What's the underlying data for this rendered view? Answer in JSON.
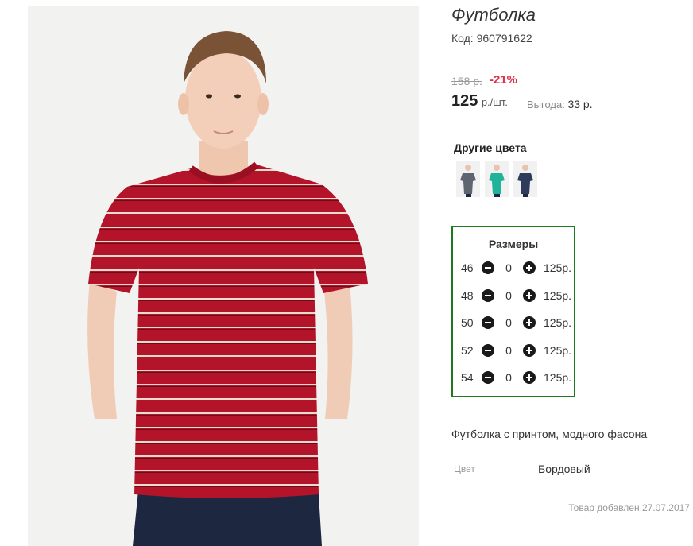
{
  "product": {
    "title": "Футболка",
    "code_label": "Код:",
    "code_value": "960791622",
    "old_price": "158 р.",
    "discount": "-21%",
    "price_value": "125",
    "price_unit": "р./шт.",
    "savings_label": "Выгода:",
    "savings_value": "33 р.",
    "photo_icon": "person-in-striped-tshirt-photo"
  },
  "other_colors": {
    "title": "Другие цвета",
    "items": [
      {
        "name": "grey",
        "color": "#5e6470"
      },
      {
        "name": "turquoise",
        "color": "#1fb39a"
      },
      {
        "name": "navy",
        "color": "#2f3b5c"
      }
    ]
  },
  "sizes": {
    "title": "Размеры",
    "rows": [
      {
        "size": "46",
        "qty": "0",
        "price": "125р."
      },
      {
        "size": "48",
        "qty": "0",
        "price": "125р."
      },
      {
        "size": "50",
        "qty": "0",
        "price": "125р."
      },
      {
        "size": "52",
        "qty": "0",
        "price": "125р."
      },
      {
        "size": "54",
        "qty": "0",
        "price": "125р."
      }
    ]
  },
  "details": {
    "description": "Футболка с принтом, модного фасона",
    "color_label": "Цвет",
    "color_value": "Бордовый",
    "added": "Товар добавлен 27.07.2017"
  },
  "colors": {
    "accent_red": "#d8304a",
    "box_border": "#1f7a1f",
    "shirt": "#b3142a"
  }
}
